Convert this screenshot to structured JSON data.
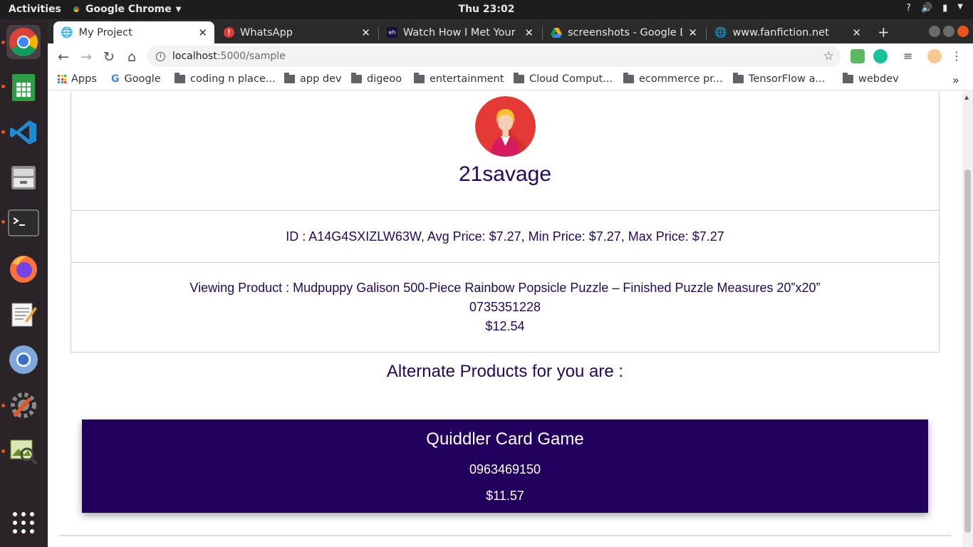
{
  "system": {
    "activities": "Activities",
    "app_name": "Google Chrome",
    "clock": "Thu 23:02"
  },
  "tabs": [
    {
      "title": "My Project",
      "active": true
    },
    {
      "title": "WhatsApp",
      "active": false
    },
    {
      "title": "Watch How I Met Your M",
      "active": false
    },
    {
      "title": "screenshots - Google Dr",
      "active": false
    },
    {
      "title": "www.fanfiction.net",
      "active": false
    }
  ],
  "address": {
    "host": "localhost",
    "path": ":5000/sample"
  },
  "bookmarks": [
    {
      "label": "Apps",
      "icon": "apps-grid-icon"
    },
    {
      "label": "Google",
      "icon": "google-icon"
    },
    {
      "label": "coding n place...",
      "icon": "folder-icon"
    },
    {
      "label": "app dev",
      "icon": "folder-icon"
    },
    {
      "label": "digeoo",
      "icon": "folder-icon"
    },
    {
      "label": "entertainment",
      "icon": "folder-icon"
    },
    {
      "label": "Cloud Comput...",
      "icon": "folder-icon"
    },
    {
      "label": "ecommerce pr...",
      "icon": "folder-icon"
    },
    {
      "label": "TensorFlow a...",
      "icon": "folder-icon"
    },
    {
      "label": "webdev",
      "icon": "folder-icon"
    }
  ],
  "profile": {
    "username": "21savage",
    "id_line": "ID : A14G4SXIZLW63W, Avg Price: $7.27, Min Price: $7.27, Max Price: $7.27"
  },
  "viewing": {
    "title_line": "Viewing Product : Mudpuppy Galison 500-Piece Rainbow Popsicle Puzzle – Finished Puzzle Measures 20”x20”",
    "product_id": "0735351228",
    "price": "$12.54"
  },
  "alternates": {
    "heading": "Alternate Products for you are :",
    "items": [
      {
        "name": "Quiddler Card Game",
        "product_id": "0963469150",
        "price": "$11.57"
      }
    ]
  },
  "colors": {
    "text_primary": "#23085c",
    "card_bg": "#22005e",
    "ubuntu_accent": "#e95420"
  }
}
